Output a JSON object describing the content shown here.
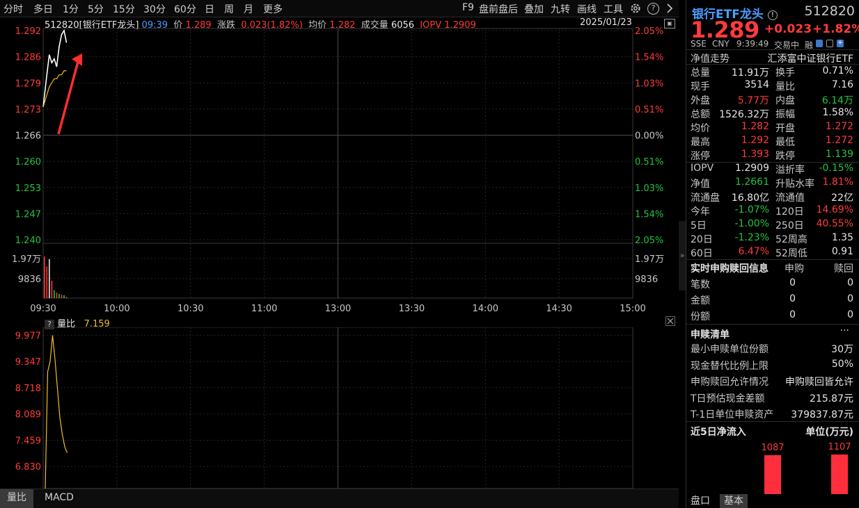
{
  "toolbar": {
    "left_items": [
      "分时",
      "多日",
      "1分",
      "5分",
      "15分",
      "30分",
      "60分",
      "日",
      "周",
      "月",
      "更多"
    ],
    "right_items": [
      "F9",
      "盘前盘后",
      "叠加",
      "九转",
      "画线",
      "工具"
    ],
    "help_glyph": "?",
    "icons": [
      "gear-icon",
      "help-icon",
      "chevron-right-icon"
    ]
  },
  "price_header": {
    "code_name": "512820[银行ETF龙头]",
    "time": "09:39",
    "price_label": "价",
    "price": "1.289",
    "change_label": "涨跌",
    "change": "0.023(1.82%)",
    "avg_label": "均价",
    "avg": "1.282",
    "volume_label": "成交量",
    "volume": "6056",
    "iopv_label": "IOPV",
    "iopv": "1.2909",
    "date": "2025/01/23"
  },
  "price_axis": {
    "left": [
      "1.292",
      "1.286",
      "1.279",
      "1.273",
      "1.266",
      "1.260",
      "1.253",
      "1.247",
      "1.240"
    ],
    "right": [
      "2.05%",
      "1.54%",
      "1.03%",
      "0.51%",
      "0.00%",
      "0.51%",
      "1.03%",
      "1.54%",
      "2.05%"
    ],
    "volume_left": [
      "1.97万",
      "9836"
    ],
    "volume_right": [
      "1.97万",
      "9836"
    ],
    "time": [
      "09:30",
      "10:00",
      "10:30",
      "11:00",
      "13:00",
      "13:30",
      "14:00",
      "14:30",
      "15:00"
    ]
  },
  "indicator_header": {
    "help": "?",
    "name": "量比",
    "value": "7.159"
  },
  "indicator_axis": [
    "9.977",
    "9.347",
    "8.718",
    "8.089",
    "7.459",
    "6.830"
  ],
  "colors": {
    "up": "#ff3b3b",
    "down": "#22c53e",
    "avg_line": "#f0c020",
    "accent": "#4d9dff"
  },
  "chart_data": [
    {
      "type": "line",
      "title": "512820[银行ETF龙头]",
      "x": [
        "09:30",
        "09:31",
        "09:32",
        "09:33",
        "09:34",
        "09:35",
        "09:36",
        "09:37",
        "09:38",
        "09:39"
      ],
      "series": [
        {
          "name": "价",
          "values": [
            1.273,
            1.281,
            1.286,
            1.284,
            1.285,
            1.283,
            1.288,
            1.291,
            1.292,
            1.289
          ]
        },
        {
          "name": "均价",
          "values": [
            1.273,
            1.276,
            1.278,
            1.279,
            1.28,
            1.28,
            1.281,
            1.281,
            1.282,
            1.282
          ]
        }
      ],
      "ylim": [
        1.24,
        1.292
      ],
      "xlim": [
        "09:30",
        "15:00"
      ]
    },
    {
      "type": "bar",
      "categories": [
        "09:30",
        "09:31",
        "09:32",
        "09:33",
        "09:34",
        "09:35",
        "09:36",
        "09:37",
        "09:38",
        "09:39"
      ],
      "values": [
        19700,
        15000,
        18500,
        8200,
        3800,
        2600,
        2000,
        1600,
        1400,
        600
      ],
      "colors": [
        "#ff3b3b",
        "#ff3b3b",
        "#e6e6e6",
        "#ff3b3b",
        "#22c53e",
        "#ff3b3b",
        "#22c53e",
        "#ff3b3b",
        "#22c53e",
        "#ff3b3b"
      ],
      "ylim": [
        0,
        26000
      ]
    },
    {
      "type": "line",
      "title": "量比",
      "x": [
        "09:30",
        "09:31",
        "09:32",
        "09:33",
        "09:34",
        "09:35",
        "09:36",
        "09:37",
        "09:38",
        "09:39"
      ],
      "series": [
        {
          "name": "量比",
          "values": [
            6.3,
            9.1,
            9.35,
            9.977,
            9.4,
            8.7,
            8.0,
            7.6,
            7.3,
            7.159
          ]
        }
      ],
      "ylim": [
        6.3,
        10.1
      ]
    }
  ],
  "right_panel": {
    "title": "银行ETF龙头",
    "code": "512820",
    "price": "1.289",
    "change": "+0.023",
    "change_pct": "+1.82%",
    "meta": [
      "SSE",
      "CNY",
      "9:39:49",
      "交易中",
      "融"
    ],
    "nav_trend_label": "净值走势",
    "fund_name": "汇添富中证银行ETF",
    "stats": [
      {
        "l1": "总量",
        "v1": "11.91万",
        "c1": "white",
        "l2": "换手",
        "v2": "0.71%",
        "c2": "white"
      },
      {
        "l1": "现手",
        "v1": "3514",
        "c1": "white",
        "l2": "量比",
        "v2": "7.16",
        "c2": "white"
      },
      {
        "l1": "外盘",
        "v1": "5.77万",
        "c1": "red",
        "l2": "内盘",
        "v2": "6.14万",
        "c2": "green"
      },
      {
        "l1": "总额",
        "v1": "1526.32万",
        "c1": "white",
        "l2": "振幅",
        "v2": "1.58%",
        "c2": "white"
      },
      {
        "l1": "均价",
        "v1": "1.282",
        "c1": "red",
        "l2": "开盘",
        "v2": "1.272",
        "c2": "red"
      },
      {
        "l1": "最高",
        "v1": "1.292",
        "c1": "red",
        "l2": "最低",
        "v2": "1.272",
        "c2": "red"
      },
      {
        "l1": "涨停",
        "v1": "1.393",
        "c1": "red",
        "l2": "跌停",
        "v2": "1.139",
        "c2": "green"
      }
    ],
    "stats2": [
      {
        "l1": "IOPV",
        "v1": "1.2909",
        "c1": "white",
        "l2": "溢折率",
        "v2": "-0.15%",
        "c2": "green"
      },
      {
        "l1": "净值",
        "v1": "1.2661",
        "c1": "green",
        "l2": "升贴水率",
        "v2": "1.81%",
        "c2": "red"
      },
      {
        "l1": "流通盘",
        "v1": "16.80亿",
        "c1": "white",
        "l2": "流通值",
        "v2": "22亿",
        "c2": "white"
      },
      {
        "l1": "今年",
        "v1": "-1.07%",
        "c1": "green",
        "l2": "120日",
        "v2": "14.69%",
        "c2": "red"
      },
      {
        "l1": "5日",
        "v1": "-1.00%",
        "c1": "green",
        "l2": "250日",
        "v2": "40.55%",
        "c2": "red"
      },
      {
        "l1": "20日",
        "v1": "-1.23%",
        "c1": "green",
        "l2": "52周高",
        "v2": "1.35",
        "c2": "white"
      },
      {
        "l1": "60日",
        "v1": "6.47%",
        "c1": "red",
        "l2": "52周低",
        "v2": "0.91",
        "c2": "white"
      }
    ],
    "sub_redeem": {
      "title": "实时申购赎回信息",
      "col1": "申购",
      "col2": "赎回",
      "rows": [
        {
          "label": "笔数",
          "v1": "0",
          "v2": "0"
        },
        {
          "label": "金额",
          "v1": "0",
          "v2": "0"
        },
        {
          "label": "份额",
          "v1": "0",
          "v2": "0"
        }
      ]
    },
    "list": {
      "title": "申赎清单",
      "more": "···",
      "rows": [
        {
          "label": "最小申赎单位份额",
          "value": "30万"
        },
        {
          "label": "现金替代比例上限",
          "value": "50%"
        },
        {
          "label": "申购赎回允许情况",
          "value": "申购赎回皆允许"
        },
        {
          "label": "T日预估现金差额",
          "value": "215.87元"
        },
        {
          "label": "T-1日单位申赎资产",
          "value": "379837.87元"
        }
      ]
    },
    "inflow": {
      "title": "近5日净流入",
      "unit": "单位(万元)",
      "labels": [
        "1087",
        "1107"
      ],
      "values": [
        1087,
        1107
      ]
    },
    "tabs": [
      "盘口",
      "基本"
    ]
  },
  "bottom_tabs": [
    "量比",
    "MACD"
  ]
}
